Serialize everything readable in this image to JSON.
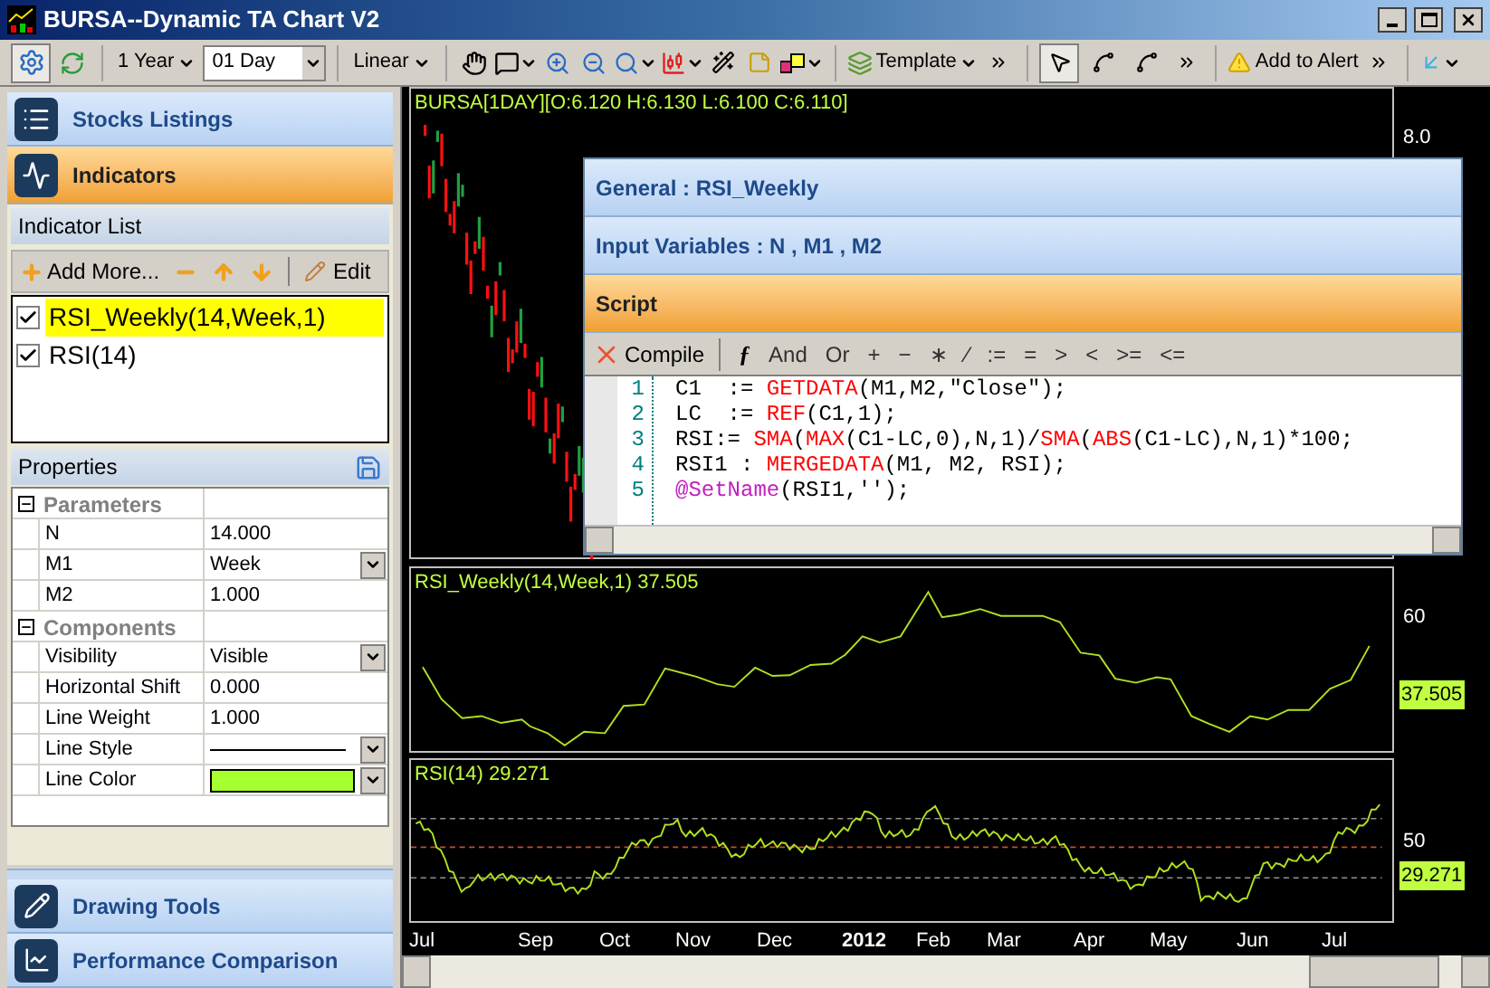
{
  "window": {
    "title": "BURSA--Dynamic TA Chart V2"
  },
  "toolbar": {
    "period": "1 Year",
    "interval": "01 Day",
    "scale": "Linear",
    "template": "Template",
    "alert": "Add to Alert",
    "settings_selected": true,
    "tools": [
      {
        "selected": true
      },
      {
        "selected": false
      },
      {
        "selected": false
      }
    ]
  },
  "sidebar": {
    "top_sections": [
      {
        "label": "Stocks Listings",
        "selected": false
      },
      {
        "label": "Indicators",
        "selected": true
      }
    ],
    "indicator_list": {
      "title": "Indicator List",
      "add": "Add More...",
      "edit": "Edit",
      "items": [
        {
          "label": "RSI_Weekly(14,Week,1)",
          "checked": true,
          "selected": true
        },
        {
          "label": "RSI(14)",
          "checked": true,
          "selected": false
        }
      ]
    },
    "properties": {
      "title": "Properties",
      "groups": [
        {
          "name": "Parameters",
          "expanded": true,
          "rows": [
            {
              "name": "N",
              "value": "14.000",
              "kind": "text"
            },
            {
              "name": "M1",
              "value": "Week",
              "kind": "dropdown"
            },
            {
              "name": "M2",
              "value": "1.000",
              "kind": "text"
            }
          ]
        },
        {
          "name": "Components",
          "expanded": true,
          "rows": [
            {
              "name": "Visibility",
              "value": "Visible",
              "kind": "dropdown"
            },
            {
              "name": "Horizontal Shift",
              "value": "0.000",
              "kind": "text"
            },
            {
              "name": "Line Weight",
              "value": "1.000",
              "kind": "text"
            },
            {
              "name": "Line Style",
              "kind": "line"
            },
            {
              "name": "Line Color",
              "kind": "color",
              "color": "#a6ff2e"
            }
          ]
        }
      ]
    },
    "bottom_sections": [
      {
        "label": "Drawing Tools",
        "selected": false
      },
      {
        "label": "Performance Comparison",
        "selected": false
      }
    ]
  },
  "editor": {
    "sections": [
      {
        "label": "General : RSI_Weekly",
        "selected": false
      },
      {
        "label": "Input Variables : N , M1 , M2",
        "selected": false
      },
      {
        "label": "Script",
        "selected": true
      }
    ],
    "compile": "Compile",
    "function": "ƒ",
    "operators": [
      "And",
      "Or",
      "+",
      "−",
      "∗",
      "∕",
      ":=",
      "=",
      ">",
      "<",
      ">=",
      "<="
    ],
    "lines": [
      {
        "number": "1",
        "tokens": [
          {
            "text": "C1  := ",
            "kind": "plain"
          },
          {
            "text": "GETDATA",
            "kind": "func"
          },
          {
            "text": "(M1,M2,\"Close\");",
            "kind": "plain"
          }
        ]
      },
      {
        "number": "2",
        "tokens": [
          {
            "text": "LC  := ",
            "kind": "plain"
          },
          {
            "text": "REF",
            "kind": "func"
          },
          {
            "text": "(C1,1);",
            "kind": "plain"
          }
        ]
      },
      {
        "number": "3",
        "tokens": [
          {
            "text": "RSI:= ",
            "kind": "plain"
          },
          {
            "text": "SMA",
            "kind": "func"
          },
          {
            "text": "(",
            "kind": "plain"
          },
          {
            "text": "MAX",
            "kind": "func"
          },
          {
            "text": "(C1-LC,0),N,1)/",
            "kind": "plain"
          },
          {
            "text": "SMA",
            "kind": "func"
          },
          {
            "text": "(",
            "kind": "plain"
          },
          {
            "text": "ABS",
            "kind": "func"
          },
          {
            "text": "(C1-LC),N,1)*100;",
            "kind": "plain"
          }
        ]
      },
      {
        "number": "4",
        "tokens": [
          {
            "text": "RSI1 : ",
            "kind": "plain"
          },
          {
            "text": "MERGEDATA",
            "kind": "func"
          },
          {
            "text": "(M1, M2, RSI);",
            "kind": "plain"
          }
        ]
      },
      {
        "number": "5",
        "tokens": [
          {
            "text": "@SetName",
            "kind": "directive"
          },
          {
            "text": "(RSI1,'');",
            "kind": "plain"
          }
        ]
      }
    ]
  },
  "charts": {
    "price": {
      "label": "BURSA[1DAY][O:6.120 H:6.130 L:6.100 C:6.110]",
      "tick": "8.0"
    },
    "weekly": {
      "label": "RSI_Weekly(14,Week,1) 37.505",
      "tick": "60",
      "last": "37.505"
    },
    "rsi": {
      "label": "RSI(14) 29.271",
      "tick": "50",
      "last": "29.271"
    },
    "x_axis": [
      {
        "label": "Jul",
        "kind": "month"
      },
      {
        "label": "Sep",
        "kind": "month"
      },
      {
        "label": "Oct",
        "kind": "month"
      },
      {
        "label": "Nov",
        "kind": "month"
      },
      {
        "label": "Dec",
        "kind": "month"
      },
      {
        "label": "2012",
        "kind": "year"
      },
      {
        "label": "Feb",
        "kind": "month"
      },
      {
        "label": "Mar",
        "kind": "month"
      },
      {
        "label": "Apr",
        "kind": "month"
      },
      {
        "label": "May",
        "kind": "month"
      },
      {
        "label": "Jun",
        "kind": "month"
      },
      {
        "label": "Jul",
        "kind": "month"
      }
    ]
  }
}
